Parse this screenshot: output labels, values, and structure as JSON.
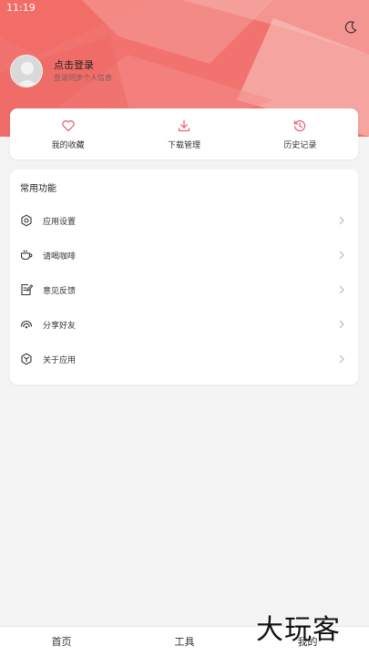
{
  "status_bar": {
    "time": "11:19"
  },
  "colors": {
    "accent": "#f0607a",
    "hero": "#f27c78"
  },
  "profile": {
    "title": "点击登录",
    "subtitle": "登录同步个人信息",
    "avatar_icon": "user-avatar-icon"
  },
  "header": {
    "theme_icon": "moon-icon"
  },
  "quick_actions": [
    {
      "label": "我的收藏",
      "icon": "heart-icon"
    },
    {
      "label": "下载管理",
      "icon": "download-icon"
    },
    {
      "label": "历史记录",
      "icon": "history-icon"
    }
  ],
  "functions": {
    "title": "常用功能",
    "items": [
      {
        "label": "应用设置",
        "icon": "gear-icon"
      },
      {
        "label": "请喝咖啡",
        "icon": "coffee-icon"
      },
      {
        "label": "意见反馈",
        "icon": "feedback-icon"
      },
      {
        "label": "分享好友",
        "icon": "share-icon"
      },
      {
        "label": "关于应用",
        "icon": "about-icon"
      }
    ]
  },
  "bottom_nav": [
    {
      "label": "首页"
    },
    {
      "label": "工具"
    },
    {
      "label": "我的"
    }
  ],
  "watermark": "大玩客"
}
